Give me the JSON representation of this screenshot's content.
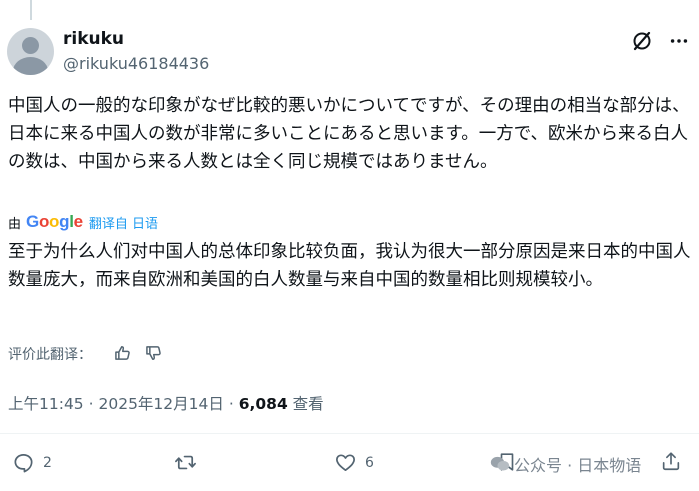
{
  "author": {
    "name": "rikuku",
    "handle": "@rikuku46184436"
  },
  "post": {
    "original_text": "中国人の一般的な印象がなぜ比較的悪いかについてですが、その理由の相当な部分は、日本に来る中国人の数が非常に多いことにあると思います。一方で、欧米から来る白人の数は、中国から来る人数とは全く同じ規模ではありません。",
    "translated_by_label": "由",
    "translator": "Google",
    "translated_from": "翻译自 日语",
    "translated_text": "至于为什么人们对中国人的总体印象比较负面，我认为很大一部分原因是来日本的中国人数量庞大，而来自欧洲和美国的白人数量与来自中国的数量相比则规模较小。",
    "rate_translation_label": "评价此翻译："
  },
  "meta": {
    "time": "上午11:45",
    "separator": "·",
    "date": "2025年12月14日",
    "views_count": "6,084",
    "views_label": "查看"
  },
  "actions": {
    "replies": "2",
    "likes": "6"
  },
  "watermark": {
    "text": "公众号 · 日本物语"
  },
  "icons": [
    "grok-icon",
    "more-icon",
    "thumbs-up-icon",
    "thumbs-down-icon",
    "reply-icon",
    "retweet-icon",
    "like-icon",
    "bookmark-icon",
    "share-icon"
  ],
  "colors": {
    "text": "#0f1419",
    "secondary": "#536471",
    "link": "#1d9bf0",
    "divider": "#eff3f4"
  }
}
